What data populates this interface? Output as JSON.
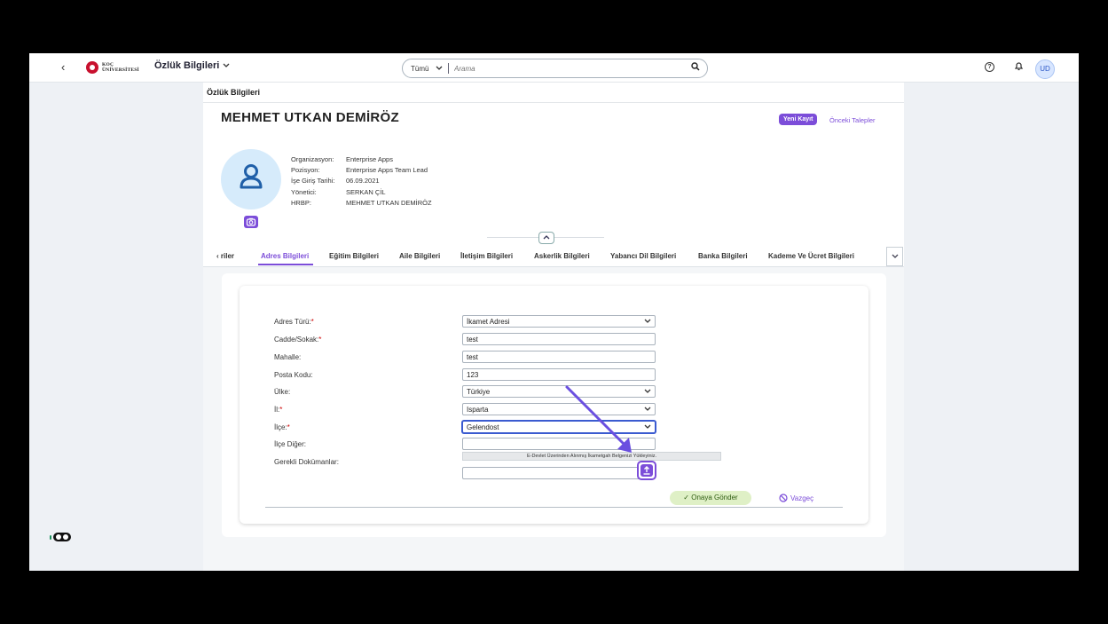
{
  "topbar": {
    "back": "‹",
    "logo_line1": "KOÇ",
    "logo_line2": "ÜNİVERSİTESİ",
    "app_title": "Özlük Bilgileri",
    "search_scope": "Tümü",
    "search_placeholder": "Arama",
    "user_initials": "UD"
  },
  "breadcrumb": "Özlük Bilgileri",
  "employee": {
    "name": "MEHMET UTKAN DEMİRÖZ",
    "new_record": "Yeni Kayıt",
    "previous_requests": "Önceki Talepler",
    "info": [
      {
        "label": "Organizasyon:",
        "value": "Enterprise Apps"
      },
      {
        "label": "Pozisyon:",
        "value": "Enterprise Apps Team Lead"
      },
      {
        "label": "İşe Giriş Tarihi:",
        "value": "06.09.2021"
      },
      {
        "label": "Yönetici:",
        "value": "SERKAN ÇİL"
      },
      {
        "label": "HRBP:",
        "value": "MEHMET UTKAN DEMİRÖZ"
      }
    ]
  },
  "tabs": {
    "items": [
      "‹ riler",
      "Adres Bilgileri",
      "Eğitim Bilgileri",
      "Aile Bilgileri",
      "İletişim Bilgileri",
      "Askerlik Bilgileri",
      "Yabancı Dil Bilgileri",
      "Banka Bilgileri",
      "Kademe Ve Ücret Bilgileri"
    ],
    "active": "Adres Bilgileri"
  },
  "form": {
    "address_type_label": "Adres Türü:",
    "address_type_value": "İkamet Adresi",
    "street_label": "Cadde/Sokak:",
    "street_value": "test",
    "neighborhood_label": "Mahalle:",
    "neighborhood_value": "test",
    "postal_label": "Posta Kodu:",
    "postal_value": "123",
    "country_label": "Ülke:",
    "country_value": "Türkiye",
    "province_label": "İl:",
    "province_value": "Isparta",
    "district_label": "İlçe:",
    "district_value": "Gelendost",
    "district_other_label": "İlçe Diğer:",
    "district_other_value": "",
    "documents_label": "Gerekli Dokümanlar:",
    "upload_note": "E-Devlet Üzerinden Alınmış İkametgah Belgenizi Yükleyiniz.",
    "submit": "Onaya Gönder",
    "cancel": "Vazgeç",
    "required_mark": "*"
  },
  "colors": {
    "accent": "#7c4dd9",
    "submit_bg": "#dff0c6",
    "photo_bg": "#d6ebfb"
  }
}
